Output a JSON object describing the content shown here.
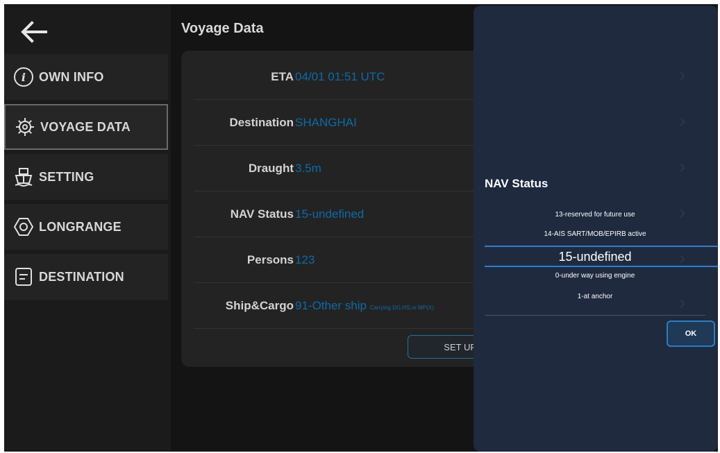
{
  "sidebar": {
    "items": [
      {
        "label": "OWN INFO",
        "icon": "info-icon"
      },
      {
        "label": "VOYAGE DATA",
        "icon": "ship-wheel-icon"
      },
      {
        "label": "SETTING",
        "icon": "ship-icon"
      },
      {
        "label": "LONGRANGE",
        "icon": "longrange-icon"
      },
      {
        "label": "DESTINATION",
        "icon": "note-icon"
      }
    ]
  },
  "main": {
    "title": "Voyage Data",
    "rows": [
      {
        "label": "ETA",
        "value": "04/01 01:51 UTC"
      },
      {
        "label": "Destination",
        "value": "SHANGHAI"
      },
      {
        "label": "Draught",
        "value": "3.5m"
      },
      {
        "label": "NAV Status",
        "value": "15-undefined"
      },
      {
        "label": "Persons",
        "value": "123"
      },
      {
        "label": "Ship&Cargo",
        "value": "91-Other ship",
        "value_small": "Carrying DG,HS,or MP(X)"
      }
    ],
    "setup_label": "SET UP"
  },
  "dialog": {
    "title": "NAV Status",
    "options_above": [
      "13-reserved for future use",
      "14-AIS SART/MOB/EPIRB active"
    ],
    "selected": "15-undefined",
    "options_below": [
      "0-under way using engine",
      "1-at anchor"
    ],
    "ok_label": "OK"
  },
  "colors": {
    "accent": "#2b80c9",
    "value_text": "#0e6aa8",
    "dialog_bg": "#1f2a3f"
  }
}
